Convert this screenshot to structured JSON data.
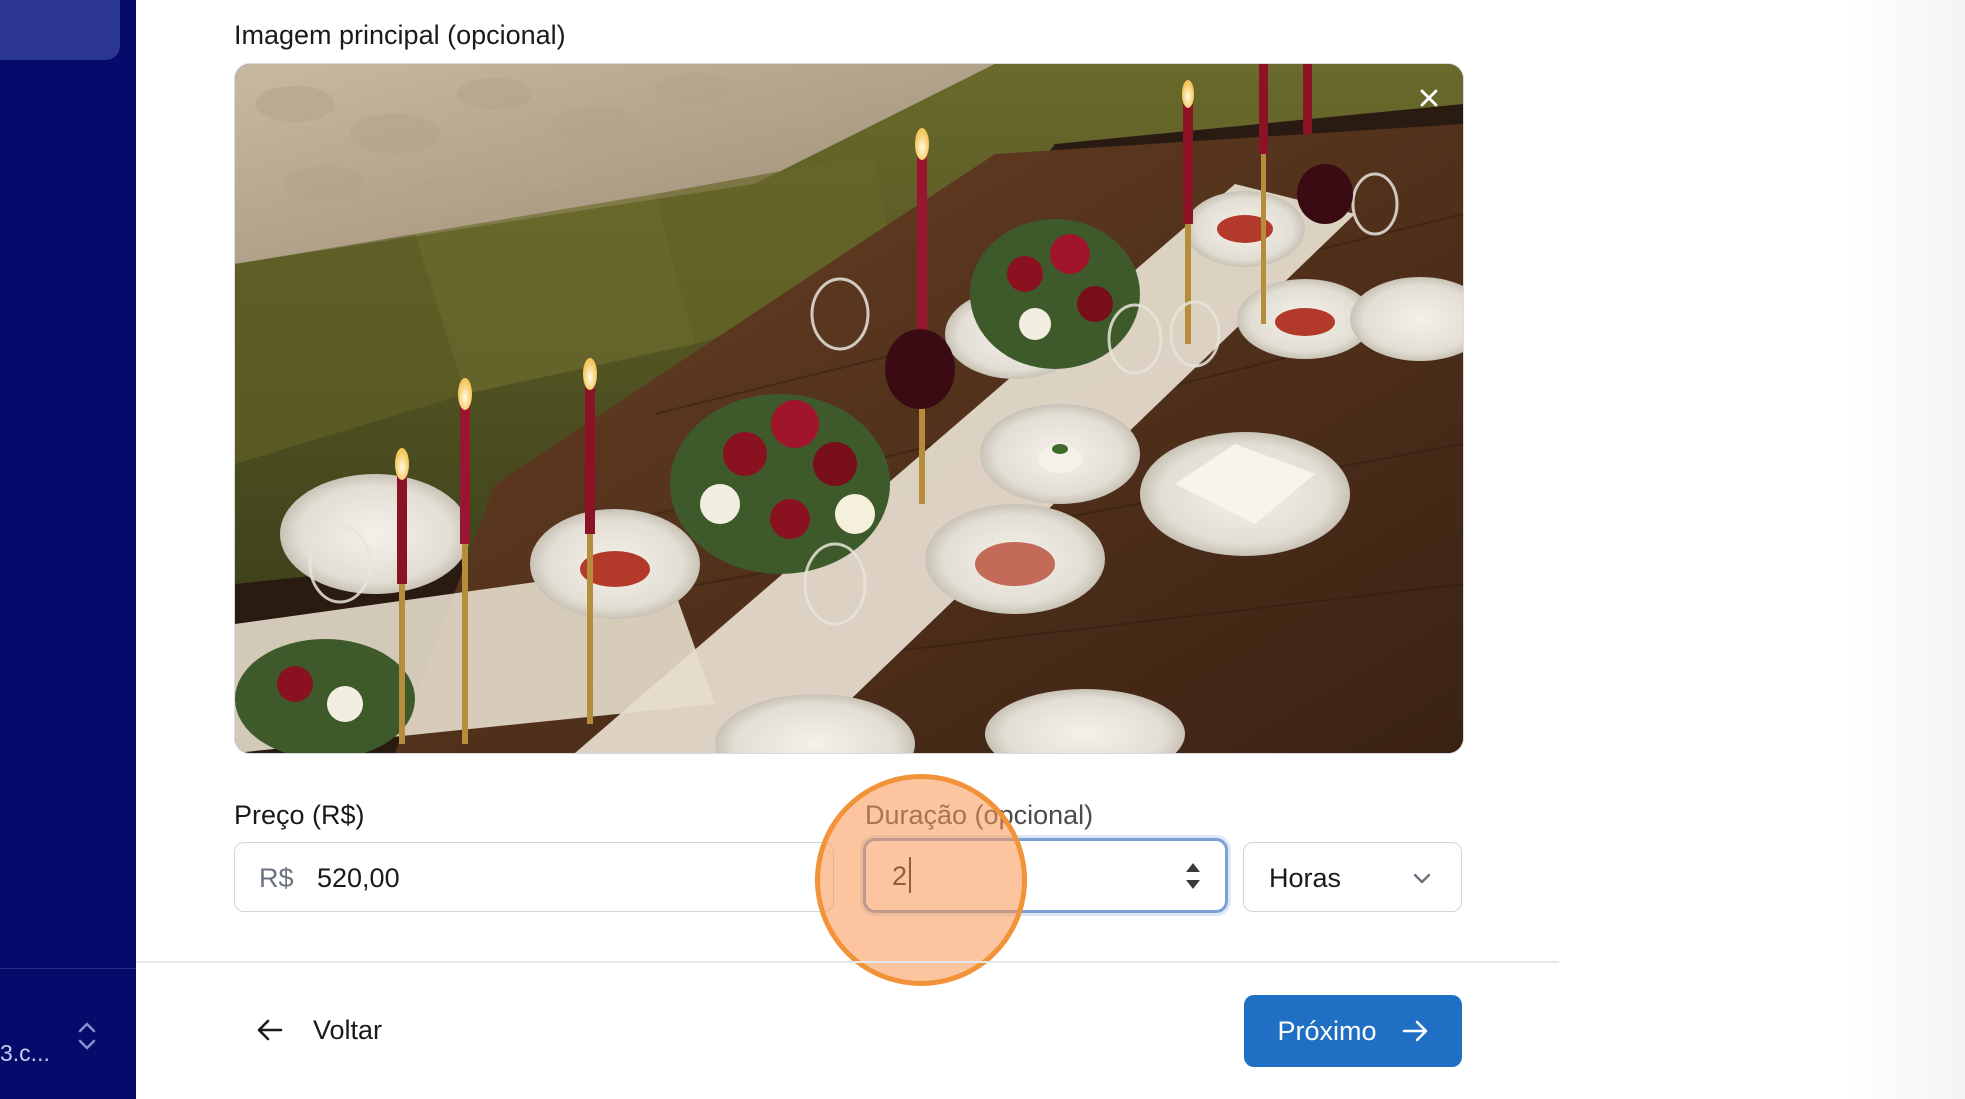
{
  "sidebar": {
    "user_text": "3.c..."
  },
  "image_section": {
    "label": "Imagem principal (opcional)",
    "image_alt": "Mesa de jantar decorada com velas, flores e pratos"
  },
  "price": {
    "label": "Preço (R$)",
    "prefix": "R$",
    "value": "520,00"
  },
  "duration": {
    "label": "Duração (opcional)",
    "value": "2",
    "unit": "Horas"
  },
  "footer": {
    "back_label": "Voltar",
    "next_label": "Próximo"
  },
  "colors": {
    "sidebar": "#050a6b",
    "primary": "#1f6fc5",
    "focus_ring": "#7aa0d6"
  }
}
